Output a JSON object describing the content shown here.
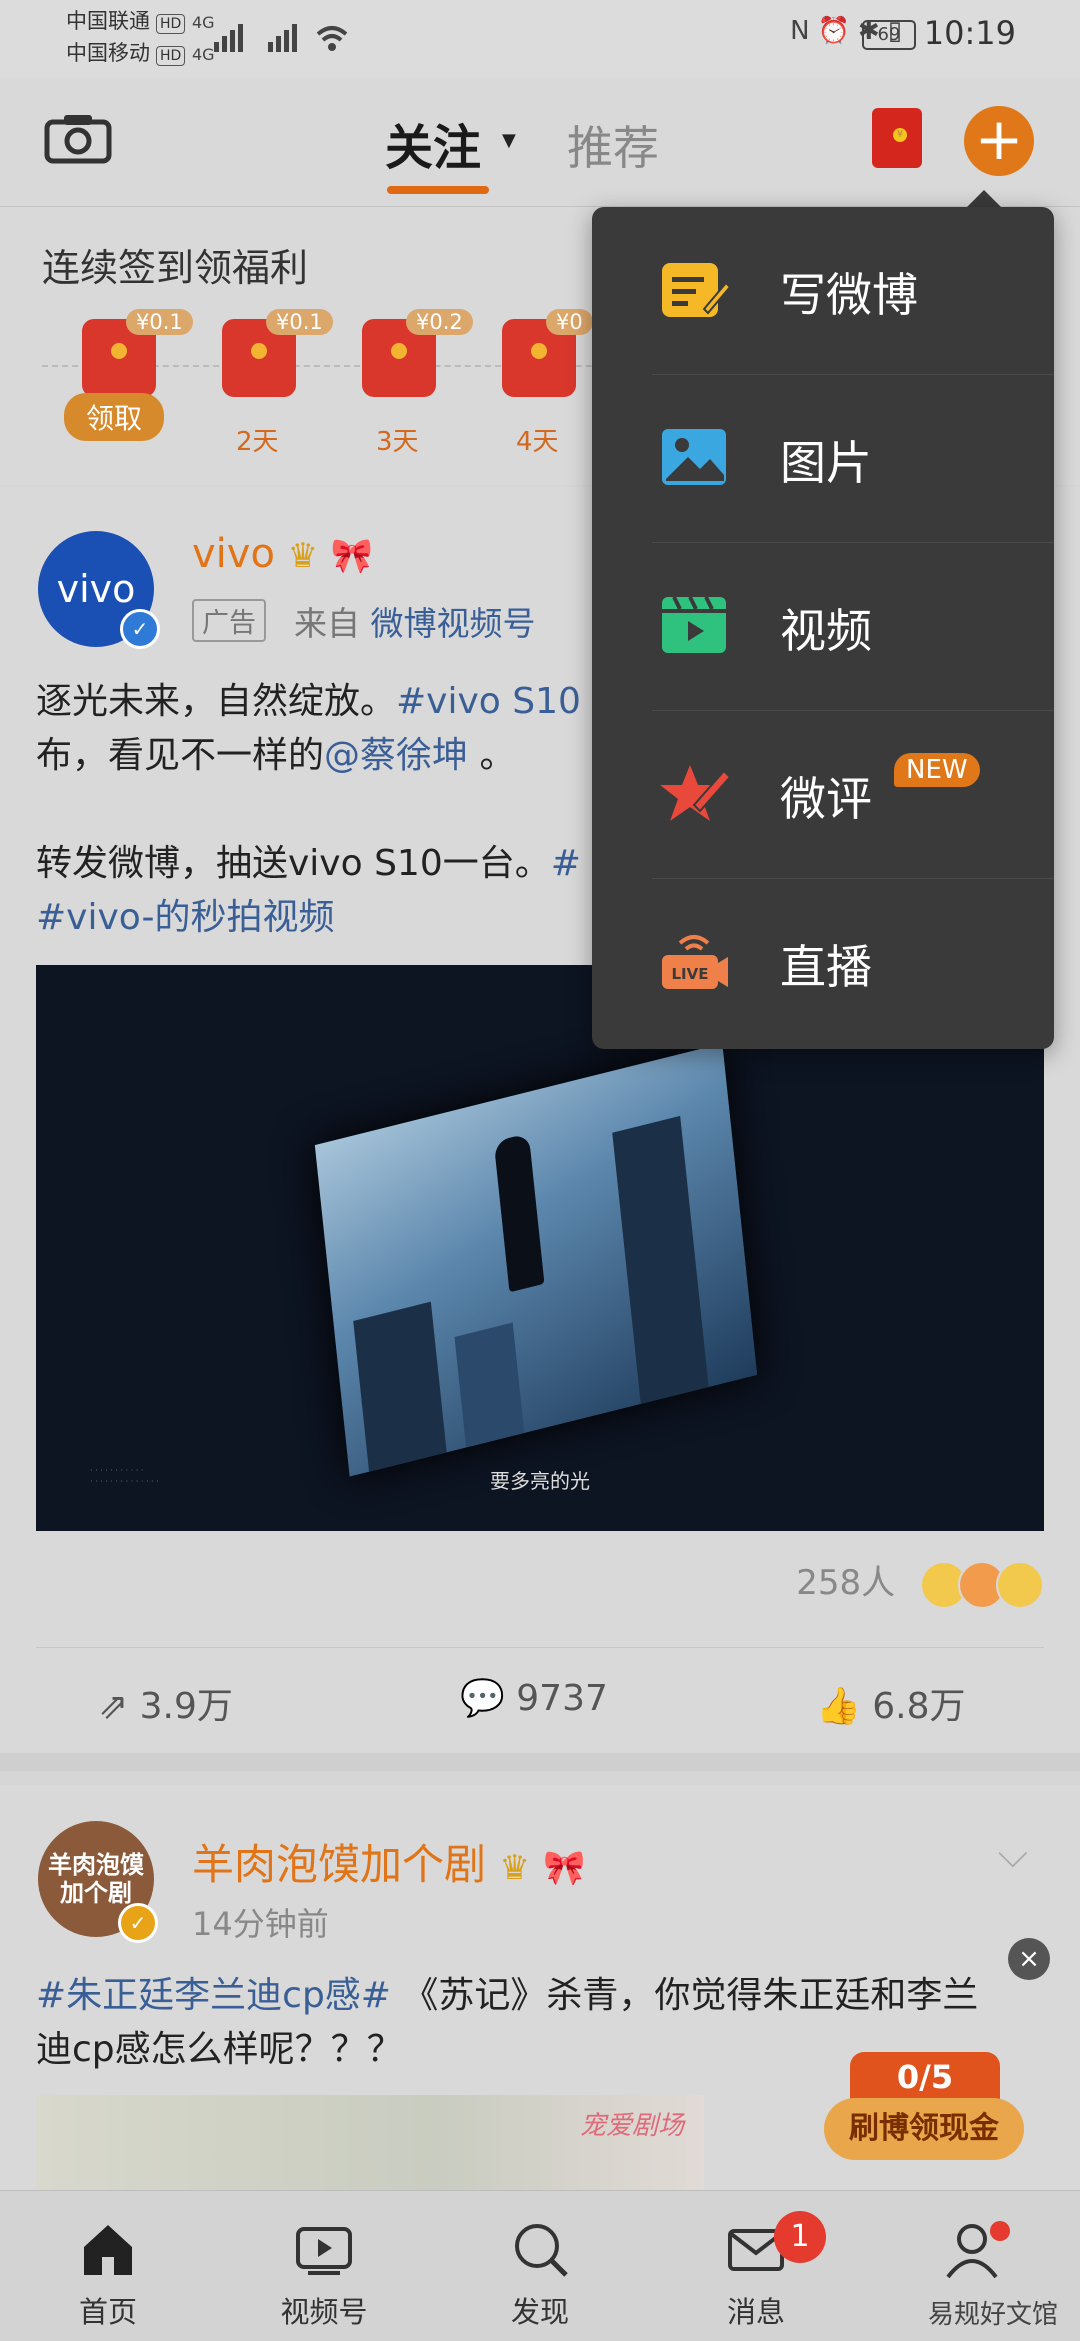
{
  "status_bar": {
    "carrier1": "中国联通",
    "carrier2": "中国移动",
    "hd": "HD",
    "net1": "4G",
    "net2": "4G",
    "battery": "69",
    "time": "10:19"
  },
  "header": {
    "tab_follow": "关注",
    "tab_recommend": "推荐"
  },
  "signin": {
    "title": "连续签到领福利",
    "items": [
      {
        "amount": "¥0.1",
        "day": "领取"
      },
      {
        "amount": "¥0.1",
        "day": "2天"
      },
      {
        "amount": "¥0.2",
        "day": "3天"
      },
      {
        "amount": "¥0",
        "day": "4天"
      }
    ]
  },
  "post1": {
    "avatar_text": "vivo",
    "name": "vivo",
    "ad_tag": "广告",
    "from_prefix": "来自",
    "from_source": "微博视频号",
    "line1_a": "逐光未来，自然绽放。",
    "line1_tag": "#vivo S10",
    "line2_a": "布，看见不一样的",
    "line2_mention": "@蔡徐坤",
    "line2_b": " 。",
    "line3_a": "转发微博，抽送vivo S10一台。",
    "line3_tag": "#",
    "line4_tag": "#vivo-的秒拍视频",
    "video_subtitle": "要多亮的光",
    "reaction_count": "258人",
    "reposts": "3.9万",
    "comments": "9737",
    "likes": "6.8万"
  },
  "post2": {
    "avatar_text": "羊肉泡馍加个剧",
    "name": "羊肉泡馍加个剧",
    "time": "14分钟前",
    "tag": "#朱正廷李兰迪cp感#",
    "text_a": " 《苏记》杀青，你觉得朱正廷和李兰",
    "text_b": "迪cp感怎么样呢？？？",
    "image_text": "宠爱剧场"
  },
  "reward": {
    "progress": "0/5",
    "label": "刷博领现金"
  },
  "tabbar": {
    "tabs": [
      "首页",
      "视频号",
      "发现",
      "消息",
      ""
    ],
    "message_badge": "1",
    "watermark": "易规好文馆"
  },
  "menu": {
    "items": [
      {
        "label": "写微博",
        "icon": "compose-icon"
      },
      {
        "label": "图片",
        "icon": "image-icon"
      },
      {
        "label": "视频",
        "icon": "video-icon"
      },
      {
        "label": "微评",
        "icon": "review-icon"
      },
      {
        "label": "直播",
        "icon": "live-icon"
      }
    ],
    "new_badge": "NEW"
  },
  "colors": {
    "accent": "#e0781a",
    "link": "#3a5f96",
    "menu_bg": "#3a3a3a"
  }
}
